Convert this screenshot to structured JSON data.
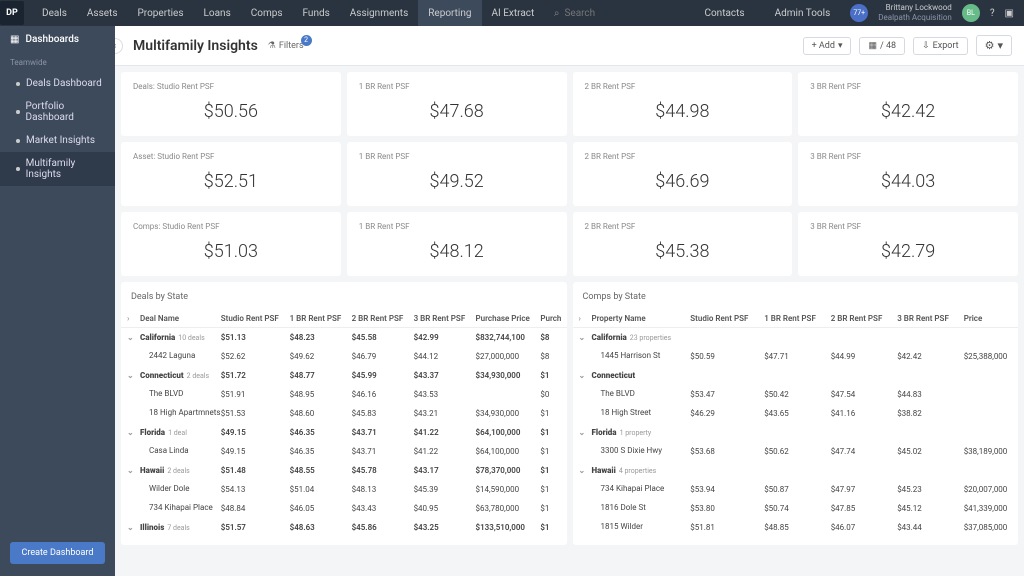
{
  "nav": {
    "logo": "DP",
    "items": [
      "Deals",
      "Assets",
      "Properties",
      "Loans",
      "Comps",
      "Funds",
      "Assignments",
      "Reporting",
      "AI Extract"
    ],
    "active": 7,
    "search_placeholder": "Search",
    "contacts": "Contacts",
    "admin": "Admin Tools",
    "badge": "77+",
    "user_name": "Brittany Lockwood",
    "user_sub": "Dealpath Acquisition",
    "user_initials": "BL"
  },
  "sidebar": {
    "title": "Dashboards",
    "section": "Teamwide",
    "items": [
      "Deals Dashboard",
      "Portfolio Dashboard",
      "Market Insights",
      "Multifamily Insights"
    ],
    "active": 3,
    "create": "Create Dashboard"
  },
  "header": {
    "title": "Multifamily Insights",
    "filters": "Filters",
    "filter_count": "2",
    "add": "+ Add",
    "count": "/ 48",
    "export": "Export"
  },
  "cards": [
    [
      {
        "l": "Deals: Studio Rent PSF",
        "v": "$50.56"
      },
      {
        "l": "1 BR Rent PSF",
        "v": "$47.68"
      },
      {
        "l": "2 BR Rent PSF",
        "v": "$44.98"
      },
      {
        "l": "3 BR Rent PSF",
        "v": "$42.42"
      }
    ],
    [
      {
        "l": "Asset: Studio Rent PSF",
        "v": "$52.51"
      },
      {
        "l": "1 BR Rent PSF",
        "v": "$49.52"
      },
      {
        "l": "2 BR Rent PSF",
        "v": "$46.69"
      },
      {
        "l": "3 BR Rent PSF",
        "v": "$44.03"
      }
    ],
    [
      {
        "l": "Comps: Studio Rent PSF",
        "v": "$51.03"
      },
      {
        "l": "1 BR Rent PSF",
        "v": "$48.12"
      },
      {
        "l": "2 BR Rent PSF",
        "v": "$45.38"
      },
      {
        "l": "3 BR Rent PSF",
        "v": "$42.79"
      }
    ]
  ],
  "deals": {
    "title": "Deals by State",
    "cols": [
      "Deal Name",
      "Studio Rent PSF",
      "1 BR Rent PSF",
      "2 BR Rent PSF",
      "3 BR Rent PSF",
      "Purchase Price",
      "Purch"
    ],
    "groups": [
      {
        "n": "California",
        "c": "10 deals",
        "v": [
          "$51.13",
          "$48.23",
          "$45.58",
          "$42.99",
          "$832,744,100",
          "$8"
        ],
        "rows": [
          [
            "2442 Laguna",
            "$52.62",
            "$49.62",
            "$46.79",
            "$44.12",
            "$27,000,000",
            "$8"
          ]
        ]
      },
      {
        "n": "Connecticut",
        "c": "2 deals",
        "v": [
          "$51.72",
          "$48.77",
          "$45.99",
          "$43.37",
          "$34,930,000",
          "$1"
        ],
        "rows": [
          [
            "The BLVD",
            "$51.91",
            "$48.95",
            "$46.16",
            "$43.53",
            "",
            "$0"
          ],
          [
            "18 High Apartmnets",
            "$51.53",
            "$48.60",
            "$45.83",
            "$43.21",
            "$34,930,000",
            "$1"
          ]
        ]
      },
      {
        "n": "Florida",
        "c": "1 deal",
        "v": [
          "$49.15",
          "$46.35",
          "$43.71",
          "$41.22",
          "$64,100,000",
          "$1"
        ],
        "rows": [
          [
            "Casa Linda",
            "$49.15",
            "$46.35",
            "$43.71",
            "$41.22",
            "$64,100,000",
            "$1"
          ]
        ]
      },
      {
        "n": "Hawaii",
        "c": "2 deals",
        "v": [
          "$51.48",
          "$48.55",
          "$45.78",
          "$43.17",
          "$78,370,000",
          "$1"
        ],
        "rows": [
          [
            "Wilder Dole",
            "$54.13",
            "$51.04",
            "$48.13",
            "$45.39",
            "$14,590,000",
            "$1"
          ],
          [
            "734 Kihapai Place",
            "$48.84",
            "$46.05",
            "$43.43",
            "$40.95",
            "$63,780,000",
            "$1"
          ]
        ]
      },
      {
        "n": "Illinois",
        "c": "7 deals",
        "v": [
          "$51.57",
          "$48.63",
          "$45.86",
          "$43.25",
          "$133,510,000",
          "$1"
        ],
        "rows": []
      }
    ]
  },
  "comps": {
    "title": "Comps by State",
    "cols": [
      "Property Name",
      "Studio Rent PSF",
      "1 BR Rent PSF",
      "2 BR Rent PSF",
      "3 BR Rent PSF",
      "Price"
    ],
    "groups": [
      {
        "n": "California",
        "c": "23 properties",
        "v": [
          "",
          "",
          "",
          "",
          ""
        ],
        "rows": [
          [
            "1445 Harrison St",
            "$50.59",
            "$47.71",
            "$44.99",
            "$42.42",
            "$25,388,000"
          ]
        ]
      },
      {
        "n": "Connecticut",
        "c": "",
        "v": [
          "",
          "",
          "",
          "",
          ""
        ],
        "rows": [
          [
            "The BLVD",
            "$53.47",
            "$50.42",
            "$47.54",
            "$44.83",
            ""
          ],
          [
            "18 High Street",
            "$46.29",
            "$43.65",
            "$41.16",
            "$38.82",
            ""
          ]
        ]
      },
      {
        "n": "Florida",
        "c": "1 property",
        "v": [
          "",
          "",
          "",
          "",
          ""
        ],
        "rows": [
          [
            "3300 S Dixie Hwy",
            "$53.68",
            "$50.62",
            "$47.74",
            "$45.02",
            "$38,189,000"
          ]
        ]
      },
      {
        "n": "Hawaii",
        "c": "4 properties",
        "v": [
          "",
          "",
          "",
          "",
          ""
        ],
        "rows": [
          [
            "734 Kihapai Place",
            "$53.94",
            "$50.87",
            "$47.97",
            "$45.23",
            "$20,007,000"
          ],
          [
            "1816 Dole St",
            "$53.80",
            "$50.74",
            "$47.85",
            "$45.12",
            "$41,339,000"
          ],
          [
            "1815 Wilder",
            "$51.81",
            "$48.85",
            "$46.07",
            "$43.44",
            "$37,085,000"
          ]
        ]
      }
    ]
  }
}
